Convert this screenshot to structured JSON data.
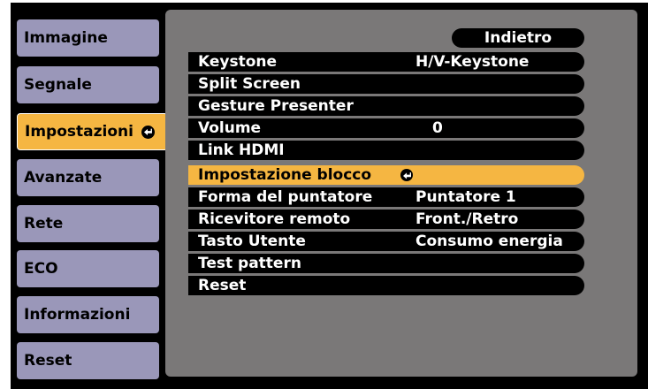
{
  "tabs": [
    "Immagine",
    "Segnale",
    "Impostazioni",
    "Avanzate",
    "Rete",
    "ECO",
    "Informazioni",
    "Reset"
  ],
  "active_tab": "Impostazioni",
  "back_label": "Indietro",
  "menu": [
    {
      "label": "Keystone",
      "value": "H/V-Keystone"
    },
    {
      "label": "Split Screen",
      "value": ""
    },
    {
      "label": "Gesture Presenter",
      "value": ""
    },
    {
      "label": "Volume",
      "value": "0"
    },
    {
      "label": "Link HDMI",
      "value": ""
    },
    {
      "label": "Impostazione blocco",
      "value": ""
    },
    {
      "label": "Forma del puntatore",
      "value": "Puntatore 1"
    },
    {
      "label": "Ricevitore remoto",
      "value": "Front./Retro"
    },
    {
      "label": "Tasto Utente",
      "value": "Consumo energia"
    },
    {
      "label": "Test pattern",
      "value": ""
    },
    {
      "label": "Reset",
      "value": ""
    }
  ],
  "selected_item": "Impostazione blocco",
  "colors": {
    "tab": "#9a97b9",
    "highlight": "#f5b642",
    "panel": "#7a7878",
    "row": "#000000"
  }
}
